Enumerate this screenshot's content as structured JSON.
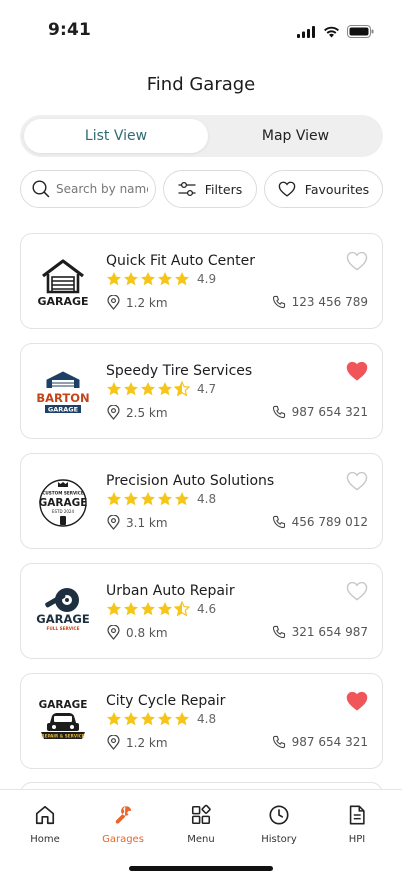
{
  "status": {
    "time": "9:41"
  },
  "header": {
    "title": "Find Garage"
  },
  "view_toggle": {
    "list_label": "List View",
    "map_label": "Map View",
    "selected": "List View"
  },
  "search": {
    "placeholder": "Search by name..."
  },
  "filters": {
    "filters_label": "Filters",
    "favourites_label": "Favourites"
  },
  "colors": {
    "accent": "#e8662b",
    "active_tab_text": "#2f6b73",
    "star": "#f5c518",
    "favourite": "#f0555a"
  },
  "garages": [
    {
      "name": "Quick Fit Auto Center",
      "rating": "4.9",
      "stars": 5,
      "distance": "1.2 km",
      "phone": "123 456 789",
      "favourite": false,
      "logo": "garage-house-logo"
    },
    {
      "name": "Speedy Tire Services",
      "rating": "4.7",
      "stars": 4.5,
      "distance": "2.5 km",
      "phone": "987 654 321",
      "favourite": true,
      "logo": "barton-garage-logo"
    },
    {
      "name": "Precision Auto Solutions",
      "rating": "4.8",
      "stars": 5,
      "distance": "3.1 km",
      "phone": "456 789 012",
      "favourite": false,
      "logo": "custom-service-garage-logo"
    },
    {
      "name": "Urban Auto Repair",
      "rating": "4.6",
      "stars": 4.5,
      "distance": "0.8 km",
      "phone": "321 654 987",
      "favourite": false,
      "logo": "tire-wrench-garage-logo"
    },
    {
      "name": "City Cycle Repair",
      "rating": "4.8",
      "stars": 5,
      "distance": "1.2 km",
      "phone": "987 654 321",
      "favourite": true,
      "logo": "car-repair-service-logo"
    }
  ],
  "logo_text": {
    "garage": "GARAGE",
    "barton": "BARTON",
    "custom_service": "CUSTOM SERVICE",
    "est": "ESTD 2024",
    "full_service": "FULL SERVICE",
    "repair_service": "REPAIR & SERVICE"
  },
  "tab_bar": {
    "items": [
      {
        "label": "Home",
        "icon": "home-icon"
      },
      {
        "label": "Garages",
        "icon": "wrench-icon",
        "active": true
      },
      {
        "label": "Menu",
        "icon": "menu-grid-icon"
      },
      {
        "label": "History",
        "icon": "clock-icon"
      },
      {
        "label": "HPI",
        "icon": "document-icon"
      }
    ]
  }
}
